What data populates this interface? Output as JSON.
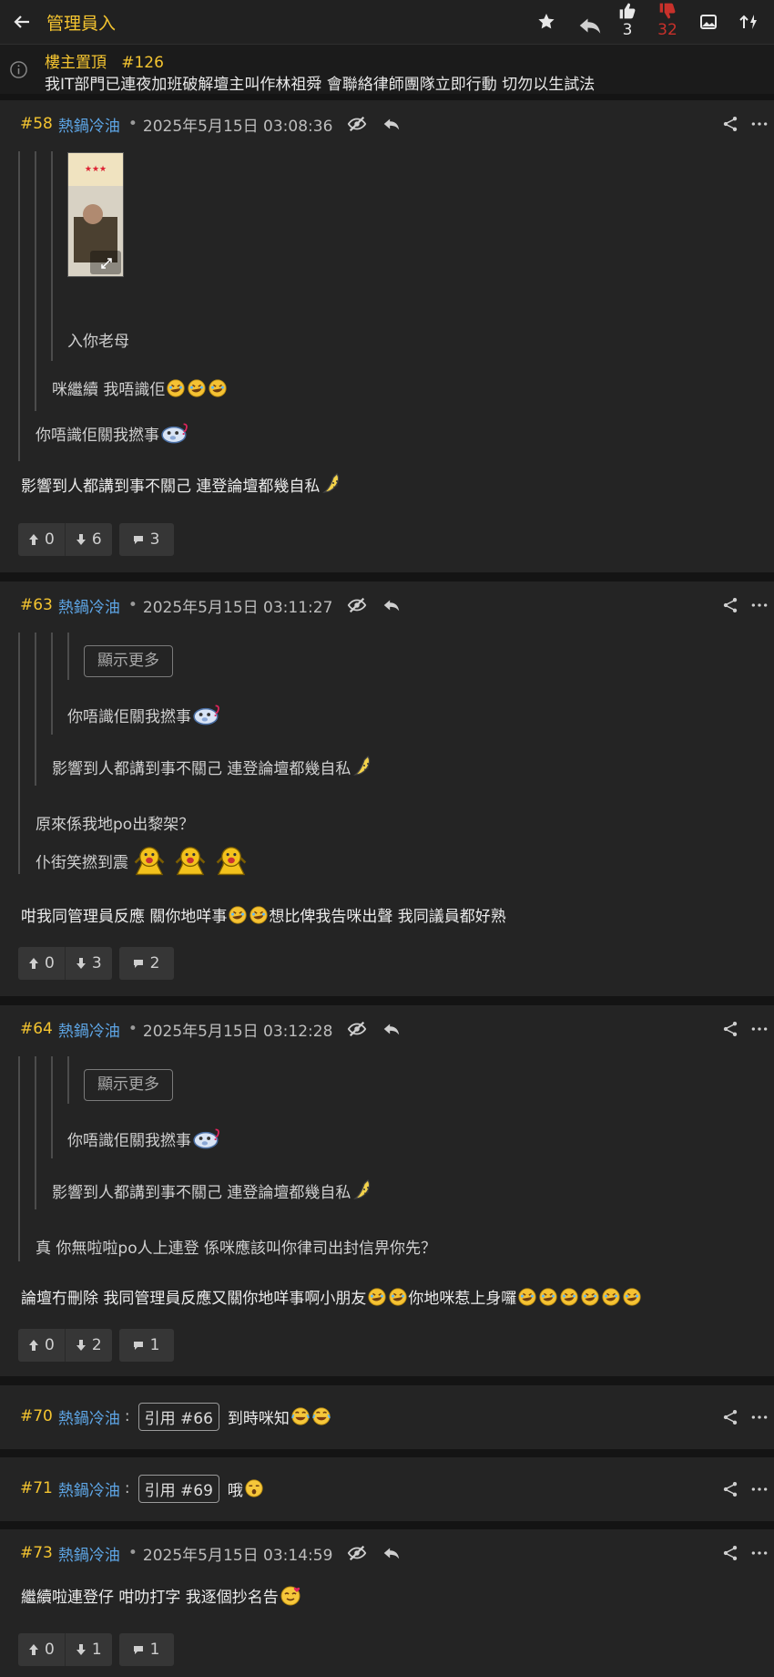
{
  "header": {
    "title": "管理員入",
    "upvotes": "3",
    "downvotes": "32"
  },
  "pinned": {
    "label": "樓主置頂",
    "ref": "#126",
    "text": "我IT部門已連夜加班破解壇主叫作林祖舜 會聯絡律師團隊立即行動 切勿以生試法"
  },
  "posts": [
    {
      "num": "#58",
      "name": "熱鍋冷油",
      "date": "2025年5月15日 03:08:36",
      "quote3": "入你老母",
      "quote2": "咪繼續 我唔識佢",
      "quote1": "你唔識佢關我撚事",
      "body": "影響到人都講到事不關己 連登論壇都幾自私",
      "up": "0",
      "down": "6",
      "comments": "3"
    },
    {
      "num": "#63",
      "name": "熱鍋冷油",
      "date": "2025年5月15日 03:11:27",
      "show_more": "顯示更多",
      "quote3": "你唔識佢關我撚事",
      "quote2": "影響到人都講到事不關己 連登論壇都幾自私",
      "quote1a": "原來係我地po出黎架？",
      "quote1b": "仆街笑撚到震",
      "body_a": "咁我同管理員反應 關你地咩事",
      "body_b": "想比俾我告咪出聲 我同議員都好熟",
      "up": "0",
      "down": "3",
      "comments": "2"
    },
    {
      "num": "#64",
      "name": "熱鍋冷油",
      "date": "2025年5月15日 03:12:28",
      "show_more": "顯示更多",
      "quote3": "你唔識佢關我撚事",
      "quote2": "影響到人都講到事不關己 連登論壇都幾自私",
      "quote1": "真 你無啦啦po人上連登 係咪應該叫你律司出封信畀你先？",
      "body_a": "論壇冇刪除 我同管理員反應又關你地咩事啊小朋友",
      "body_b": "你地咪惹上身囉",
      "up": "0",
      "down": "2",
      "comments": "1"
    },
    {
      "num": "#70",
      "name": "熱鍋冷油",
      "quote_label": "引用 #66",
      "text": "到時咪知"
    },
    {
      "num": "#71",
      "name": "熱鍋冷油",
      "quote_label": "引用 #69",
      "text": "哦"
    },
    {
      "num": "#73",
      "name": "熱鍋冷油",
      "date": "2025年5月15日 03:14:59",
      "body": "繼續啦連登仔 咁叻打字 我逐個抄名告",
      "up": "0",
      "down": "1",
      "comments": "1"
    }
  ],
  "colors": {
    "accent": "#f4c430",
    "username": "#5ea6e6",
    "downvote": "#c8312b"
  }
}
